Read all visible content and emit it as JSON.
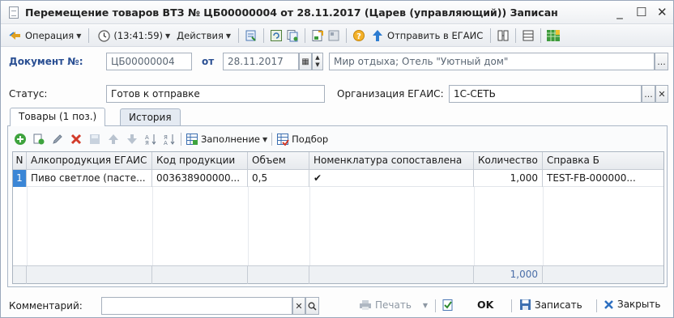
{
  "window": {
    "title": "Перемещение товаров ВТЗ № ЦБ00000004 от 28.11.2017 (Царев (управляющий)) Записан",
    "controls": [
      "_",
      "☐",
      "✕"
    ]
  },
  "toolbar": {
    "operation": "Операция",
    "time": "(13:41:59)",
    "actions": "Действия",
    "send_egais": "Отправить в ЕГАИС"
  },
  "doc": {
    "number_label": "Документ №:",
    "number_value": "ЦБ00000004",
    "date_label": "от",
    "date_value": "28.11.2017",
    "warehouse_value": "Мир отдыха; Отель \"Уютный дом\"",
    "warehouse_btn": "..."
  },
  "status": {
    "label": "Статус:",
    "value": "Готов к отправке",
    "org_label": "Организация ЕГАИС:",
    "org_value": "1С-СЕТЬ",
    "org_btn": "...",
    "org_clear": "✕"
  },
  "tabs": [
    {
      "label": "Товары (1 поз.)"
    },
    {
      "label": "История"
    }
  ],
  "tab_toolbar": {
    "fill": "Заполнение",
    "pick": "Подбор"
  },
  "table": {
    "columns": [
      "N",
      "Алкопродукция ЕГАИС",
      "Код продукции",
      "Объем",
      "Номенклатура сопоставлена",
      "Количество",
      "Справка Б"
    ],
    "rows": [
      {
        "n": "1",
        "product": "Пиво светлое (пасте...",
        "code": "003638900000...",
        "volume": "0,5",
        "matched": "✔",
        "qty": "1,000",
        "ref": "TEST-FB-000000..."
      }
    ],
    "footer_total": "1,000"
  },
  "bottom": {
    "comment_label": "Комментарий:",
    "comment_value": "",
    "print": "Печать",
    "ok": "OK",
    "save": "Записать",
    "close": "Закрыть"
  }
}
